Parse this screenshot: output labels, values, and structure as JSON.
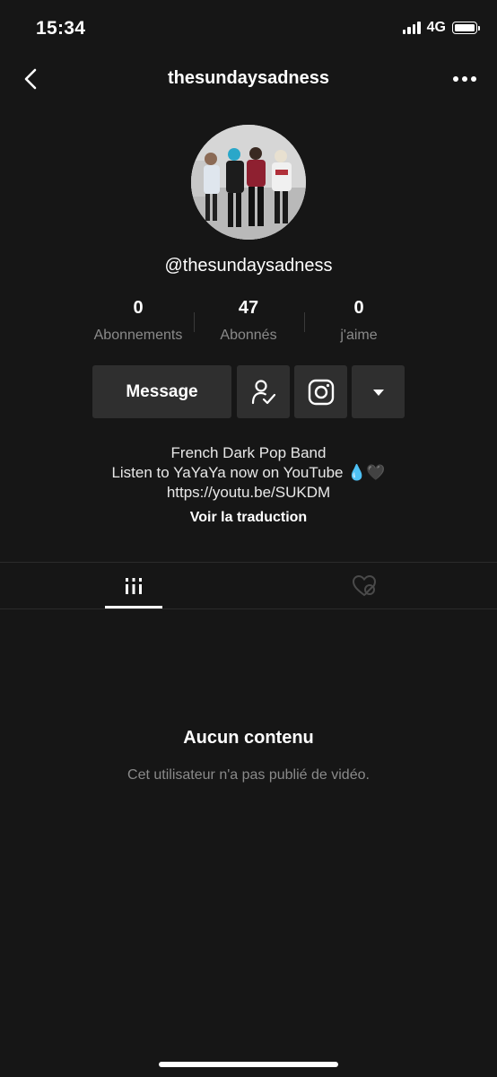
{
  "status_bar": {
    "time": "15:34",
    "network": "4G",
    "battery_percent": 100
  },
  "nav": {
    "title": "thesundaysadness",
    "back_icon": "chevron-left-icon",
    "more_icon": "ellipsis-icon"
  },
  "profile": {
    "handle": "@thesundaysadness",
    "stats": [
      {
        "value": "0",
        "label": "Abonnements"
      },
      {
        "value": "47",
        "label": "Abonnés"
      },
      {
        "value": "0",
        "label": "j'aime"
      }
    ],
    "buttons": {
      "message_label": "Message",
      "follow_icon": "user-check-icon",
      "instagram_icon": "instagram-icon",
      "dropdown_icon": "caret-down-icon"
    },
    "bio": {
      "line1": "French Dark Pop Band",
      "line2": "Listen to YaYaYa now on YouTube",
      "line2_emoji": "💧🖤",
      "line3": "https://youtu.be/SUKDM"
    },
    "translate_label": "Voir la traduction"
  },
  "tabs": [
    {
      "name": "videos",
      "icon": "grid-icon",
      "active": true
    },
    {
      "name": "liked",
      "icon": "hidden-heart-icon",
      "active": false
    }
  ],
  "empty_state": {
    "title": "Aucun contenu",
    "subtitle": "Cet utilisateur n'a pas publié de vidéo."
  },
  "colors": {
    "background": "#161616",
    "button": "#2f2f2f",
    "muted_text": "#8a8a8a"
  }
}
